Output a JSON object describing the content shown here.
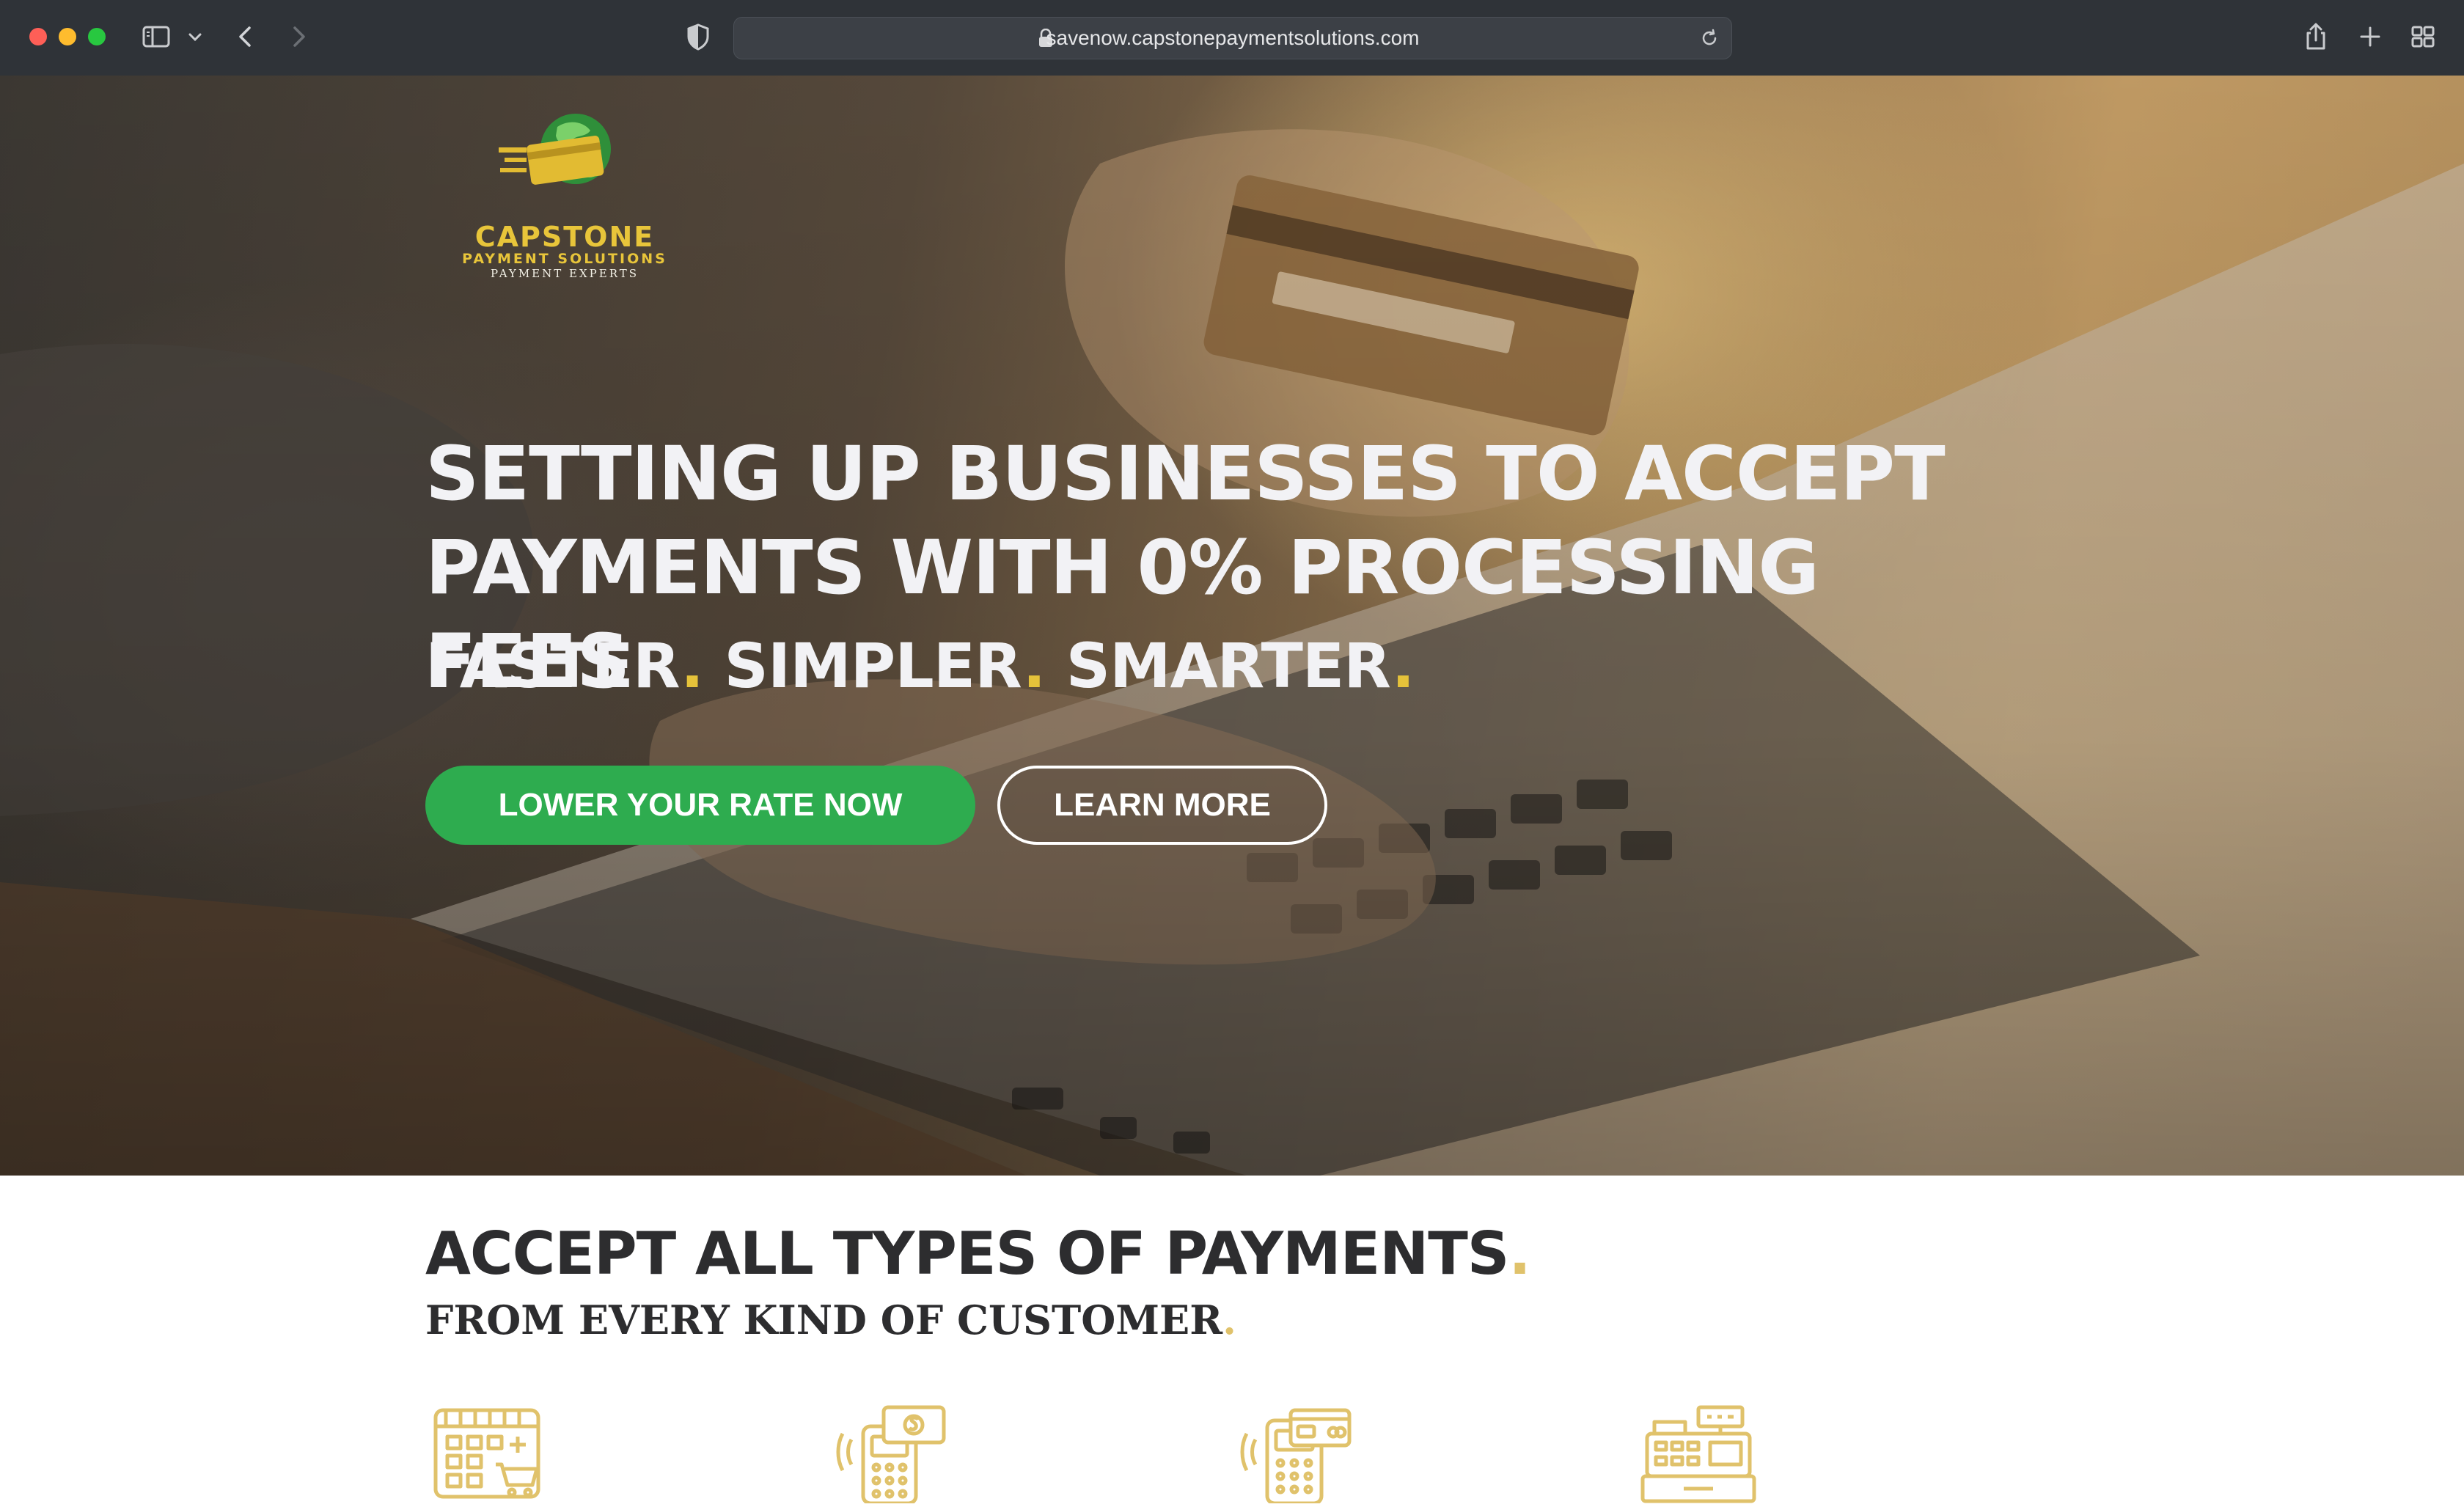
{
  "browser": {
    "url": "savenow.capstonepaymentsolutions.com",
    "icons": [
      "sidebar-icon",
      "chevron-down-icon",
      "back-icon",
      "forward-icon",
      "shield-icon",
      "lock-icon",
      "reload-icon",
      "share-icon",
      "new-tab-icon",
      "tab-overview-icon"
    ]
  },
  "logo": {
    "name": "CAPSTONE",
    "subtitle": "PAYMENT SOLUTIONS",
    "tagline": "PAYMENT EXPERTS",
    "colors": {
      "gold": "#e8c53a",
      "globe": "#2f8f3a"
    }
  },
  "hero": {
    "headline": "SETTING UP BUSINESSES TO ACCEPT PAYMENTS WITH 0% PROCESSING FEES",
    "tagline": {
      "word1": "FASTER",
      "word2": "SIMPLER",
      "word3": "SMARTER",
      "punct": "."
    },
    "primary_button": "LOWER YOUR RATE NOW",
    "secondary_button": "LEARN MORE",
    "accent": "#e5c23a",
    "primary_color": "#2eac4f"
  },
  "section": {
    "title": "ACCEPT ALL TYPES OF PAYMENTS",
    "subtitle": "FROM EVERY KIND OF CUSTOMER",
    "punct": ".",
    "icons": [
      "online-store-icon",
      "contactless-terminal-icon",
      "card-terminal-icon",
      "cash-register-icon"
    ],
    "icon_color": "#e0c26b"
  }
}
